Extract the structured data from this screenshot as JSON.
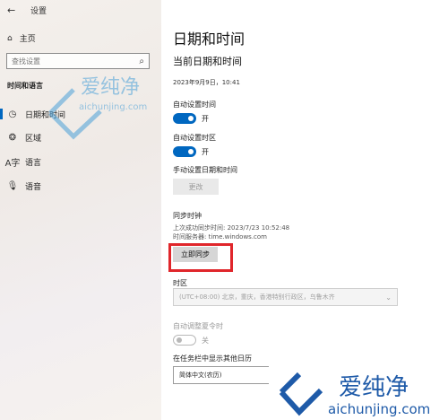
{
  "window": {
    "back_icon": "back-arrow-icon",
    "title": "设置"
  },
  "sidebar": {
    "home_label": "主页",
    "search_placeholder": "查找设置",
    "section_title": "时间和语言",
    "items": [
      {
        "label": "日期和时间",
        "icon": "clock-calendar-icon",
        "active": true
      },
      {
        "label": "区域",
        "icon": "globe-icon",
        "active": false
      },
      {
        "label": "语言",
        "icon": "language-icon",
        "active": false
      },
      {
        "label": "语音",
        "icon": "microphone-icon",
        "active": false
      }
    ]
  },
  "main": {
    "page_title": "日期和时间",
    "sub_title": "当前日期和时间",
    "datetime": "2023年9月9日，10:41",
    "auto_time": {
      "label": "自动设置时间",
      "state": "开",
      "on": true
    },
    "auto_timezone": {
      "label": "自动设置时区",
      "state": "开",
      "on": true
    },
    "manual": {
      "label": "手动设置日期和时间",
      "button": "更改"
    },
    "sync": {
      "label": "同步时钟",
      "last_sync": "上次成功同步时间: 2023/7/23 10:52:48",
      "server": "时间服务器: time.windows.com",
      "button": "立即同步"
    },
    "timezone": {
      "label": "时区",
      "value": "(UTC+08:00) 北京，重庆，香港特别行政区，乌鲁木齐"
    },
    "dst": {
      "label": "自动调整夏令时",
      "state": "关",
      "on": false
    },
    "calendar": {
      "label": "在任务栏中显示其他日历",
      "value": "简体中文(农历)"
    }
  },
  "watermark": {
    "text": "爱纯净",
    "url": "aichunjing.com"
  },
  "colors": {
    "accent": "#0067c0",
    "highlight": "#e0262b"
  }
}
